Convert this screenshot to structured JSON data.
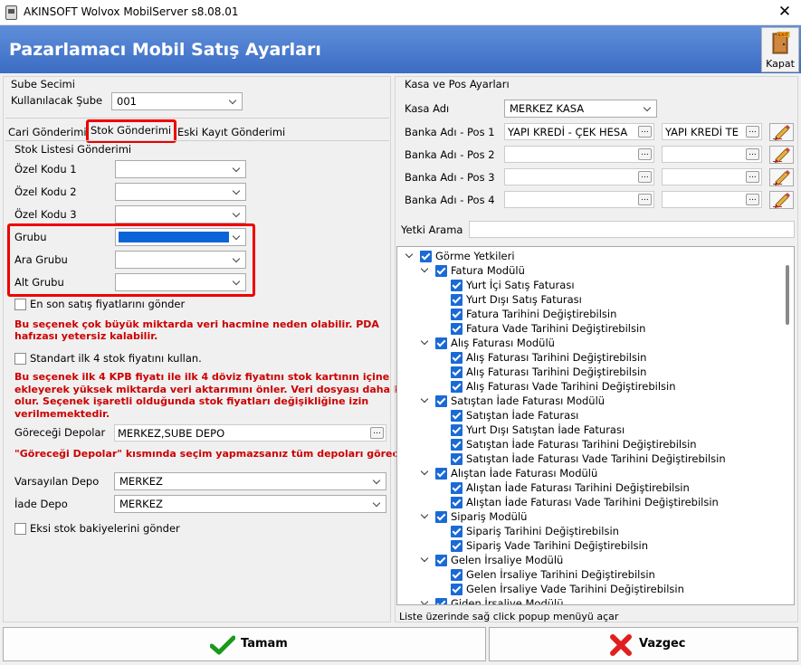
{
  "window": {
    "title": "AKINSOFT Wolvox MobilServer s8.08.01",
    "close_glyph": "✕"
  },
  "header": {
    "title": "Pazarlamacı Mobil Satış Ayarları",
    "close_label": "Kapat",
    "door_sign": "EXIT"
  },
  "left": {
    "branch_group_title": "Sube Secimi",
    "branch_label": "Kullanılacak Şube",
    "branch_value": "001",
    "tabs": [
      "Cari Gönderimi",
      "Stok Gönderimi",
      "Eski Kayıt Gönderimi"
    ],
    "stock_group_title": "Stok Listesi Gönderimi",
    "fields": {
      "ozel1": "Özel Kodu 1",
      "ozel2": "Özel Kodu 2",
      "ozel3": "Özel Kodu 3",
      "grubu": "Grubu",
      "ara_grubu": "Ara Grubu",
      "alt_grubu": "Alt Grubu"
    },
    "check_last_sale": "En son satış fiyatlarını gönder",
    "warn1": [
      "Bu seçenek çok büyük miktarda veri hacmine neden olabilir. PDA",
      "hafızası yetersiz kalabilir."
    ],
    "check_standard_prices": "Standart ilk 4 stok fiyatını kullan.",
    "warn2": [
      "Bu seçenek ilk 4 KPB fiyatı ile ilk 4 döviz fiyatını stok kartının içine",
      "ekleyerek yüksek miktarda veri aktarımını önler. Veri dosyası daha küçük",
      "olur. Seçenek işaretli olduğunda stok fiyatları değişikliğine izin",
      "verilmemektedir."
    ],
    "depots_label": "Göreceği Depolar",
    "depots_value": "MERKEZ,SUBE DEPO",
    "depots_warn": "\"Göreceği Depolar\" kısmında seçim yapmazsanız tüm depoları görecektir.",
    "default_depot_label": "Varsayılan Depo",
    "default_depot_value": "MERKEZ",
    "return_depot_label": "İade Depo",
    "return_depot_value": "MERKEZ",
    "check_negative": "Eksi stok bakiyelerini gönder",
    "ellipsis": "...",
    "accent_highlight": "#e00000",
    "selected_fill": "#0a64d8"
  },
  "right": {
    "group_title": "Kasa ve Pos Ayarları",
    "kasa_label": "Kasa Adı",
    "kasa_value": "MERKEZ KASA",
    "pos": [
      {
        "label": "Banka Adı - Pos 1",
        "bank": "YAPI KREDİ - ÇEK HESA",
        "account": "YAPI KREDİ TE"
      },
      {
        "label": "Banka Adı - Pos 2",
        "bank": "",
        "account": ""
      },
      {
        "label": "Banka Adı - Pos 3",
        "bank": "",
        "account": ""
      },
      {
        "label": "Banka Adı - Pos 4",
        "bank": "",
        "account": ""
      }
    ],
    "search_label": "Yetki Arama",
    "search_value": "",
    "tree": [
      {
        "level": 0,
        "text": "Görme Yetkileri",
        "expand": true
      },
      {
        "level": 1,
        "text": "Fatura Modülü",
        "expand": true
      },
      {
        "level": 2,
        "text": "Yurt İçi Satış Faturası"
      },
      {
        "level": 2,
        "text": "Yurt Dışı Satış Faturası"
      },
      {
        "level": 2,
        "text": "Fatura Tarihini Değiştirebilsin"
      },
      {
        "level": 2,
        "text": "Fatura Vade Tarihini Değiştirebilsin"
      },
      {
        "level": 1,
        "text": "Alış Faturası Modülü",
        "expand": true
      },
      {
        "level": 2,
        "text": "Alış Faturası Tarihini Değiştirebilsin"
      },
      {
        "level": 2,
        "text": "Alış Faturası Tarihini Değiştirebilsin"
      },
      {
        "level": 2,
        "text": "Alış Faturası Vade Tarihini Değiştirebilsin"
      },
      {
        "level": 1,
        "text": "Satıştan İade Faturası Modülü",
        "expand": true
      },
      {
        "level": 2,
        "text": "Satıştan İade Faturası"
      },
      {
        "level": 2,
        "text": "Yurt Dışı Satıştan İade Faturası"
      },
      {
        "level": 2,
        "text": "Satıştan İade Faturası Tarihini Değiştirebilsin"
      },
      {
        "level": 2,
        "text": "Satıştan İade Faturası Vade Tarihini Değiştirebilsin"
      },
      {
        "level": 1,
        "text": "Alıştan İade Faturası Modülü",
        "expand": true
      },
      {
        "level": 2,
        "text": "Alıştan İade Faturası Tarihini Değiştirebilsin"
      },
      {
        "level": 2,
        "text": "Alıştan İade Faturası Vade Tarihini Değiştirebilsin"
      },
      {
        "level": 1,
        "text": "Sipariş Modülü",
        "expand": true
      },
      {
        "level": 2,
        "text": "Sipariş Tarihini Değiştirebilsin"
      },
      {
        "level": 2,
        "text": "Sipariş Vade Tarihini Değiştirebilsin"
      },
      {
        "level": 1,
        "text": "Gelen İrsaliye Modülü",
        "expand": true
      },
      {
        "level": 2,
        "text": "Gelen İrsaliye Tarihini Değiştirebilsin"
      },
      {
        "level": 2,
        "text": "Gelen İrsaliye Vade Tarihini Değiştirebilsin"
      },
      {
        "level": 1,
        "text": "Giden İrsaliye Modülü",
        "expand": true
      }
    ],
    "tree_hint": "Liste üzerinde sağ click popup menüyü açar"
  },
  "footer": {
    "ok_label": "Tamam",
    "cancel_label": "Vazgec"
  },
  "icons": {
    "app": "app-icon",
    "close": "close-icon",
    "door": "exit-door-icon",
    "pencil": "pencil-icon",
    "ok": "check-icon",
    "cancel": "x-icon",
    "dropdown": "chevron-down-icon",
    "ellipsis": "ellipsis-icon"
  }
}
